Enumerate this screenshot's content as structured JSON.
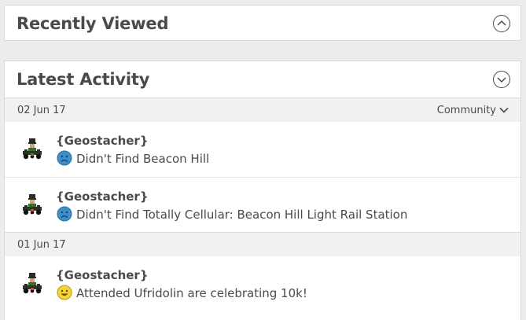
{
  "recently_viewed": {
    "title": "Recently Viewed",
    "toggle_icon": "chevron-up-circle-icon"
  },
  "latest_activity": {
    "title": "Latest Activity",
    "toggle_icon": "chevron-down-circle-icon",
    "filter_label": "Community",
    "groups": [
      {
        "date": "02 Jun 17",
        "entries": [
          {
            "user": "{Geostacher}",
            "log_type": "didnt-find",
            "cache": "Didn't Find Beacon Hill"
          },
          {
            "user": "{Geostacher}",
            "log_type": "didnt-find",
            "cache": "Didn't Find Totally Cellular: Beacon Hill Light Rail Station"
          }
        ]
      },
      {
        "date": "01 Jun 17",
        "entries": [
          {
            "user": "{Geostacher}",
            "log_type": "attended",
            "cache": "Attended Ufridolin are celebrating 10k!"
          }
        ]
      }
    ]
  },
  "colors": {
    "page_bg": "#ececec",
    "panel_bg": "#ffffff",
    "date_bar_bg": "#f1f1f1",
    "text": "#4a4a4a",
    "dnf_icon": "#3d8fc9",
    "attended_icon": "#f4d43a"
  }
}
